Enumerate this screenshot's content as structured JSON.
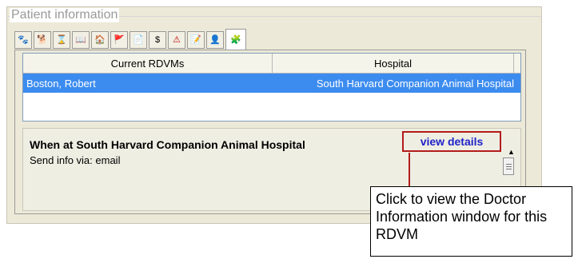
{
  "group": {
    "title": "Patient information"
  },
  "tabs": [
    {
      "icon": "paw-icon",
      "glyph": "🐾"
    },
    {
      "icon": "dog-icon",
      "glyph": "🐕"
    },
    {
      "icon": "hourglass-icon",
      "glyph": "⌛"
    },
    {
      "icon": "book-icon",
      "glyph": "📖"
    },
    {
      "icon": "house-icon",
      "glyph": "🏠"
    },
    {
      "icon": "flag-icon",
      "glyph": "🚩"
    },
    {
      "icon": "page-icon",
      "glyph": "📄"
    },
    {
      "icon": "ledger-icon",
      "glyph": "$"
    },
    {
      "icon": "alert-icon",
      "glyph": "⚠"
    },
    {
      "icon": "note-icon",
      "glyph": "📝"
    },
    {
      "icon": "person-icon",
      "glyph": "👤"
    },
    {
      "icon": "puzzle-icon",
      "glyph": "🧩"
    }
  ],
  "grid": {
    "columns": [
      "Current RDVMs",
      "Hospital"
    ],
    "rows": [
      {
        "doctor": "Boston, Robert",
        "hospital": "South Harvard Companion Animal Hospital"
      }
    ]
  },
  "info": {
    "title": "When at South Harvard Companion Animal Hospital",
    "send_info": "Send info via: email",
    "view_details": "view details"
  },
  "callout": {
    "text": "Click to view the Doctor Information window for this RDVM"
  },
  "colors": {
    "selection": "#3c8cf0",
    "callout_red": "#b31b1b",
    "link_blue": "#1f22c8"
  }
}
